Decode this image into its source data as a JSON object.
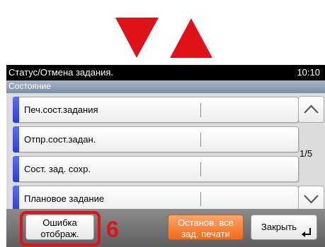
{
  "header": {
    "title": "Статус/Отмена задания.",
    "time": "10:10"
  },
  "section": {
    "title": "Состояние"
  },
  "list": {
    "items": [
      {
        "label": "Печ.сост.задания"
      },
      {
        "label": "Отпр.сост.задан."
      },
      {
        "label": "Сост. зад. сохр."
      },
      {
        "label": "Плановое задание"
      }
    ],
    "page_indicator": "1/5"
  },
  "footer": {
    "error_display_label": "Ошибка отображ.",
    "stop_all_label": "Останов. все зад. печати",
    "close_label": "Закрыть"
  },
  "callout": {
    "number": "6"
  },
  "colors": {
    "accent": "#e01219",
    "orange": "#f06a1a",
    "row_bar": "#3a4fe0"
  },
  "icons": [
    "triangle-down-icon",
    "triangle-up-icon",
    "chevron-up-icon",
    "chevron-down-icon",
    "enter-icon"
  ]
}
